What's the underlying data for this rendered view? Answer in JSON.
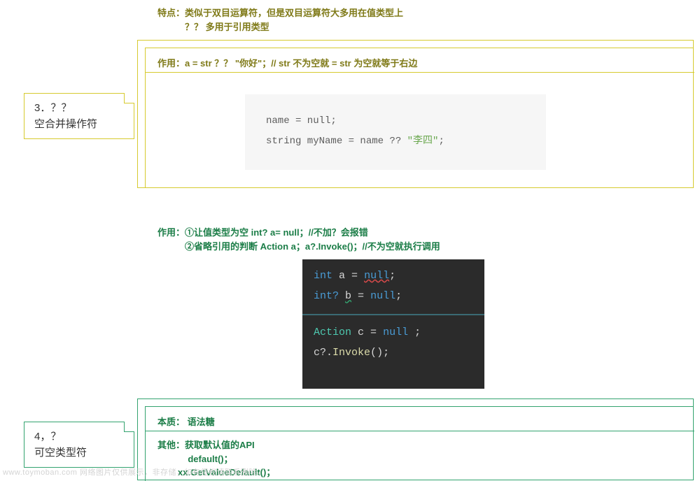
{
  "section1": {
    "heading_l1": "特点：类似于双目运算符，但是双目运算符大多用在值类型上",
    "heading_l2": "　　　？？  多用于引用类型",
    "usage": "作用：a = str ？？  \"你好\"；// str  不为空就 = str 为空就等于右边",
    "code_l1": "name = null;",
    "code_l2a": "string myName = name ?? ",
    "code_l2b": "\"李四\"",
    "code_l2c": ";",
    "box_l1": "3．？？",
    "box_l2": "空合并操作符"
  },
  "section2": {
    "heading_l1": "作用：①让值类型为空   int? a= null；//不加？会报错",
    "heading_l2": "　　　②省略引用的判断  Action a；a?.Invoke()；//不为空就执行调用",
    "code": {
      "kw_int": "int",
      "kw_intq": "int?",
      "kw_null": "null",
      "cls_action": "Action",
      "var_a": "a",
      "var_b": "b",
      "var_c": "c",
      "fn_invoke": "Invoke",
      "eq": " = ",
      "semi": ";",
      "space": " ",
      "qdot": "?.",
      "lp": "(",
      "rp": ")"
    },
    "essence": "本质： 语法糖",
    "other_l1": "其他：获取默认值的API",
    "other_l2": "            default()；",
    "other_l3": "        xx.GetValueDefault()；",
    "box_l1": "4，？",
    "box_l2": "可空类型符"
  },
  "watermark": "www.toymoban.com 网络图片仅供展示，非存储，如有侵权请联系删除。"
}
